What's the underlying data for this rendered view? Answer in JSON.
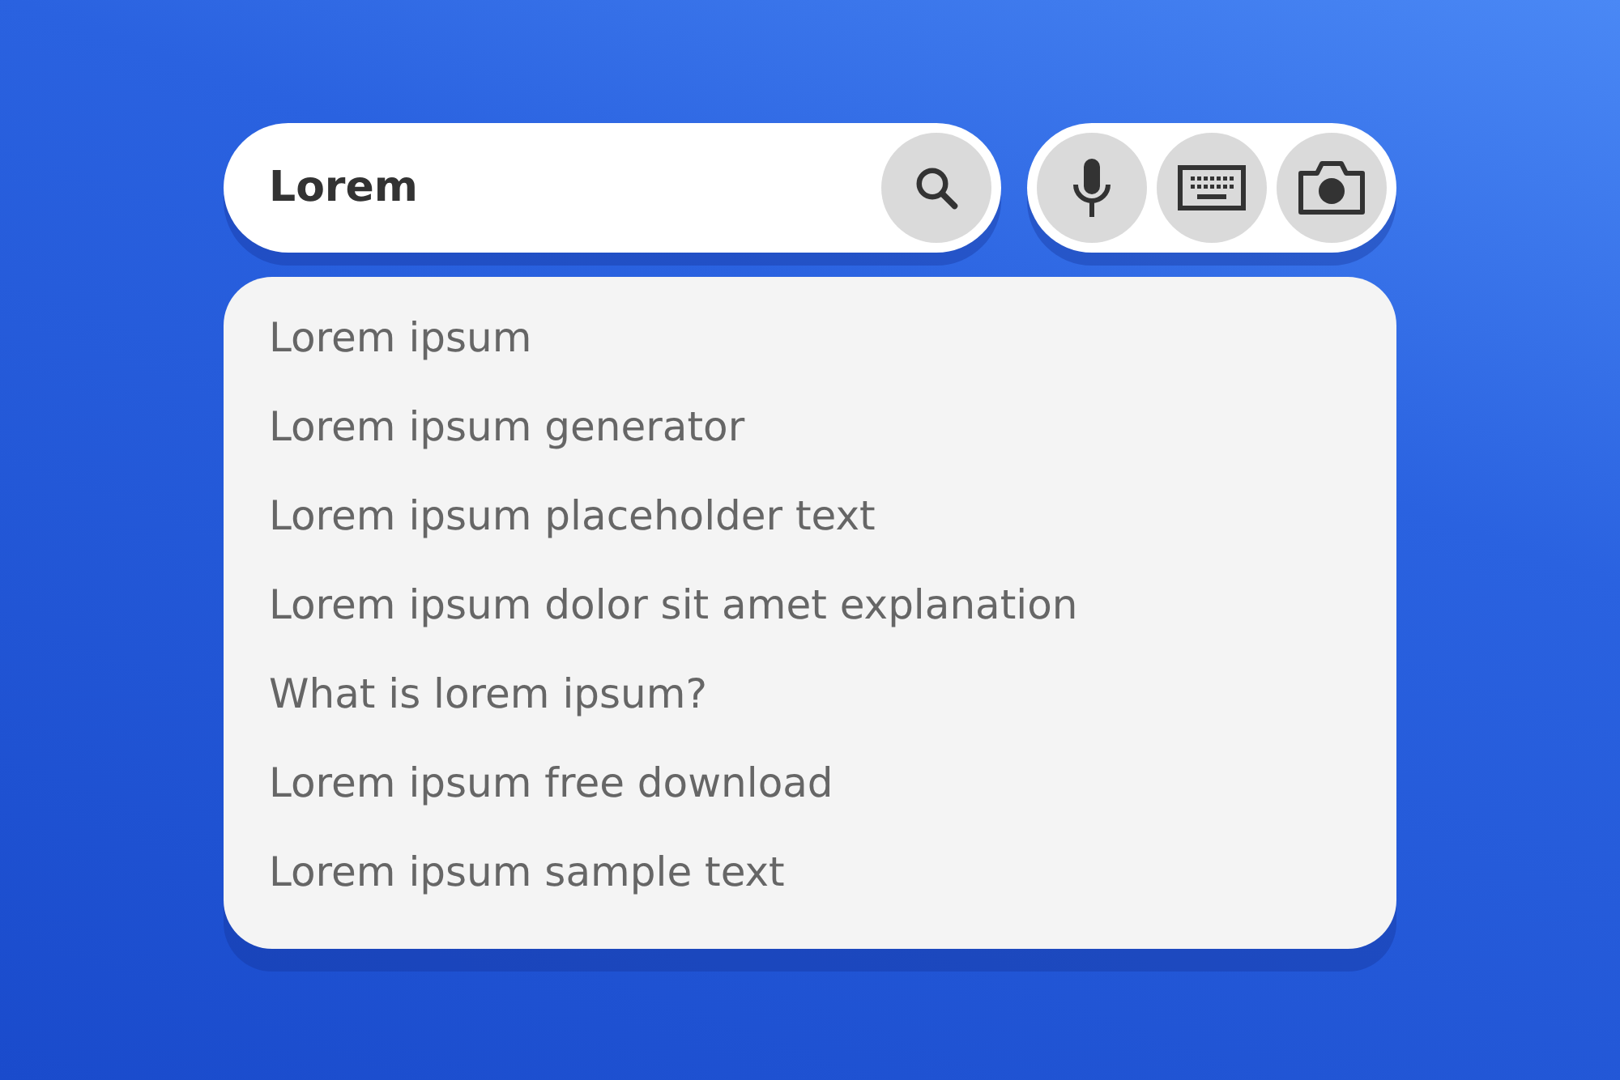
{
  "search": {
    "value": "Lorem"
  },
  "suggestions": [
    "Lorem ipsum",
    "Lorem ipsum generator",
    "Lorem ipsum placeholder text",
    "Lorem ipsum dolor sit amet explanation",
    "What is lorem ipsum?",
    "Lorem ipsum free download",
    "Lorem ipsum sample text"
  ]
}
